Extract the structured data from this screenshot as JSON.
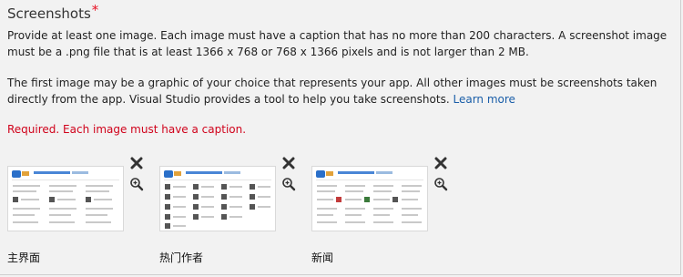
{
  "section": {
    "title": "Screenshots",
    "required_marker": "*",
    "description_1": "Provide at least one image. Each image must have a caption that has no more than 200 characters. A screenshot image must be a .png file that is at least 1366 x 768 or 768 x 1366 pixels and is not larger than 2 MB.",
    "description_2": "The first image may be a graphic of your choice that represents your app. All other images must be screenshots taken directly from the app. Visual Studio provides a tool to help you take screenshots.",
    "learn_more": "Learn more",
    "error": "Required. Each image must have a caption."
  },
  "screenshots": [
    {
      "caption": "主界面",
      "remove_icon": "close-icon",
      "zoom_icon": "zoom-in-icon"
    },
    {
      "caption": "热门作者",
      "remove_icon": "close-icon",
      "zoom_icon": "zoom-in-icon"
    },
    {
      "caption": "新闻",
      "remove_icon": "close-icon",
      "zoom_icon": "zoom-in-icon"
    }
  ],
  "colors": {
    "required": "#e81123",
    "error": "#d0021b",
    "link": "#1a5ea8"
  }
}
